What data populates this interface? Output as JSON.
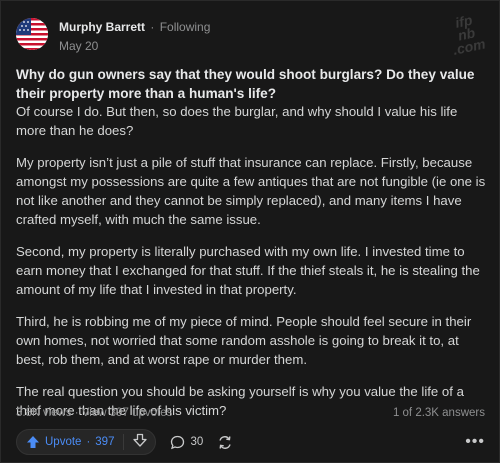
{
  "author": {
    "name": "Murphy Barrett",
    "separator": "·",
    "follow_status": "Following",
    "date": "May 20"
  },
  "question": "Why do gun owners say that they would shoot burglars? Do they value their property more than a human's life?",
  "answer_paragraphs": [
    "Of course I do. But then, so does the burglar, and why should I value his life more than he does?",
    "My property isn’t just a pile of stuff that insurance can replace. Firstly, because amongst my possessions are quite a few antiques that are not fungible (ie one is not like another and they cannot be simply replaced), and many items I have crafted myself, with much the same issue.",
    "Second, my property is literally purchased with my own life. I invested time to earn money that I exchanged for that stuff. If the thief steals it, he is stealing the amount of my life that I invested in that property.",
    "Third, he is robbing me of my piece of mind. People should feel secure in their own homes, not worried that some random asshole is going to break it to, at best, rob them, and at worst rape or murder them.",
    "The real question you should be asking yourself is why you value the life of a thief more than the life of his victim?"
  ],
  "stats": {
    "views_upvotes": "3.8K views · View 397 upvotes",
    "answer_position": "1 of 2.3K answers"
  },
  "actions": {
    "upvote_label": "Upvote",
    "upvote_sep": "·",
    "upvote_count": "397",
    "comment_count": "30",
    "more": "•••"
  },
  "colors": {
    "background": "#181818",
    "upvote_blue": "#4b8cf5",
    "muted_text": "#8e8f90"
  },
  "icons": [
    "us-flag-avatar",
    "upvote-arrow-icon",
    "downvote-arrow-icon",
    "comment-icon",
    "share-icon",
    "more-icon"
  ]
}
